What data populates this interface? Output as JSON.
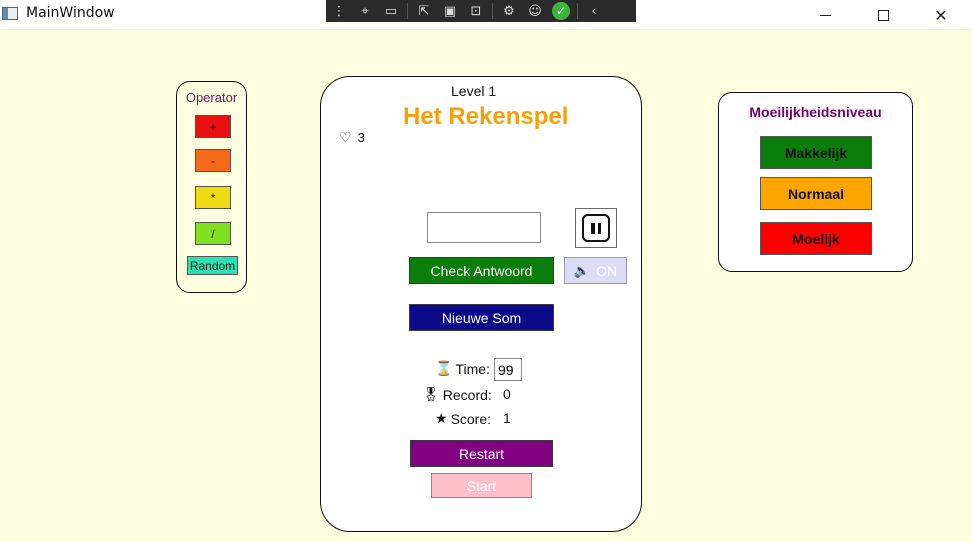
{
  "window": {
    "title": "MainWindow"
  },
  "operator_panel": {
    "title": "Operator",
    "buttons": [
      {
        "label": "+",
        "color": "#e81010"
      },
      {
        "label": "-",
        "color": "#f56a1a"
      },
      {
        "label": "*",
        "color": "#eedc10"
      },
      {
        "label": "/",
        "color": "#7fe020"
      }
    ],
    "random": {
      "label": "Random",
      "color": "#2ee0b0"
    }
  },
  "game": {
    "level_label": "Level  1",
    "title": "Het Rekenspel",
    "lives": "3",
    "answer_value": "",
    "check_button": "Check Antwoord",
    "sound_button": "ON",
    "new_sum_button": "Nieuwe Som",
    "time_label": "Time:",
    "time_value": "99",
    "record_label": "Record:",
    "record_value": "0",
    "score_label": "Score:",
    "score_value": "1",
    "restart_button": "Restart",
    "start_button": "Start",
    "colors": {
      "title": "#f5a009",
      "check": "#0a7d0a",
      "new_sum": "#0b0b8a",
      "restart": "#820082",
      "start": "#ffc0cb"
    }
  },
  "difficulty_panel": {
    "title": "Moeilijkheidsniveau",
    "buttons": [
      {
        "label": "Makkelijk",
        "color": "#0a7d0a"
      },
      {
        "label": "Normaal",
        "color": "#ffa500"
      },
      {
        "label": "Moelijk",
        "color": "#ff0000"
      }
    ]
  }
}
